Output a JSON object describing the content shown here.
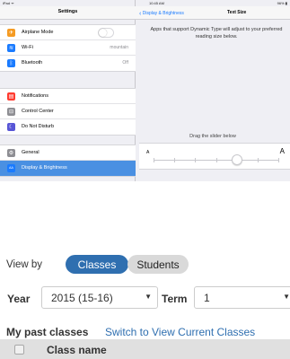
{
  "ipad": {
    "status": {
      "carrier": "iPad ᯤ",
      "time": "10:45 AM",
      "battery": "96% ▮"
    },
    "settings_title": "Settings",
    "groups": [
      [
        {
          "name": "airplane",
          "label": "Airplane Mode",
          "icon": "airplane-icon",
          "color": "#f59b23",
          "glyph": "✈",
          "toggle": true
        },
        {
          "name": "wifi",
          "label": "Wi-Fi",
          "icon": "wifi-icon",
          "color": "#1a7bff",
          "glyph": "≋",
          "value": "mountain"
        },
        {
          "name": "bluetooth",
          "label": "Bluetooth",
          "icon": "bluetooth-icon",
          "color": "#1a7bff",
          "glyph": "ᛒ",
          "value": "Off"
        }
      ],
      [
        {
          "name": "notifications",
          "label": "Notifications",
          "icon": "notifications-icon",
          "color": "#ff3b30",
          "glyph": "▤"
        },
        {
          "name": "control-center",
          "label": "Control Center",
          "icon": "control-center-icon",
          "color": "#8e8e93",
          "glyph": "⊟"
        },
        {
          "name": "do-not-disturb",
          "label": "Do Not Disturb",
          "icon": "moon-icon",
          "color": "#5856d6",
          "glyph": "☾"
        }
      ],
      [
        {
          "name": "general",
          "label": "General",
          "icon": "gear-icon",
          "color": "#8e8e93",
          "glyph": "⚙"
        },
        {
          "name": "display-brightness",
          "label": "Display & Brightness",
          "icon": "display-brightness-icon",
          "color": "#1a7bff",
          "glyph": "AA",
          "selected": true
        }
      ]
    ],
    "detail": {
      "back_label": "Display & Brightness",
      "title": "Text Size",
      "description": "Apps that support Dynamic Type will adjust to your preferred reading size below.",
      "drag_label": "Drag the slider below",
      "small_a": "A",
      "big_a": "A",
      "slider_steps": 7,
      "slider_value_step": 4
    }
  },
  "classes": {
    "view_by_label": "View by",
    "tabs": {
      "classes": "Classes",
      "students": "Students"
    },
    "active_tab": "Classes",
    "year_label": "Year",
    "year_value": "2015 (15-16)",
    "term_label": "Term",
    "term_value": "1",
    "past_classes_title": "My past classes",
    "switch_link": "Switch to View Current Classes",
    "column_header": "Class name",
    "colors": {
      "accent": "#2f6fb0",
      "pill_inactive": "#d9d9d9",
      "header_bg": "#e0e0e0"
    }
  }
}
